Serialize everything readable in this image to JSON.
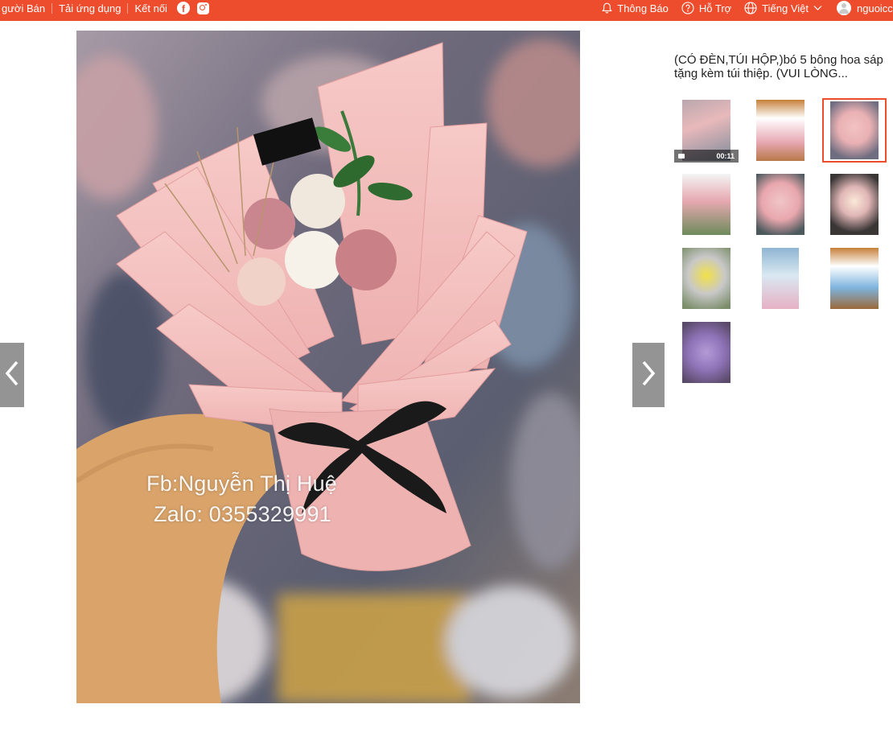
{
  "topbar": {
    "left_links": [
      "gười Bán",
      "Tải ứng dụng",
      "Kết nối"
    ],
    "notifications": "Thông Báo",
    "help": "Hỗ Trợ",
    "language": "Tiếng Việt",
    "username": "nguoicc"
  },
  "product": {
    "title": "(CÓ ĐÈN,TÚI HỘP,)bó 5 bông hoa sáp tặng kèm túi thiệp. (VUI LÒNG...",
    "watermark_line1": "Fb:Nguyễn Thị Huệ",
    "watermark_line2": "Zalo: 0355329991"
  },
  "gallery": {
    "video_duration": "00:11",
    "active_index": 2,
    "thumbnail_count": 10
  },
  "colors": {
    "brand": "#ee4d2d",
    "wrap_pink": "#f1b8b8",
    "ribbon": "#1a1a1a"
  },
  "icons": {
    "prev": "chevron-left-icon",
    "next": "chevron-right-icon",
    "facebook": "facebook-icon",
    "instagram": "instagram-icon",
    "bell": "bell-icon",
    "help": "help-icon",
    "globe": "globe-icon"
  }
}
